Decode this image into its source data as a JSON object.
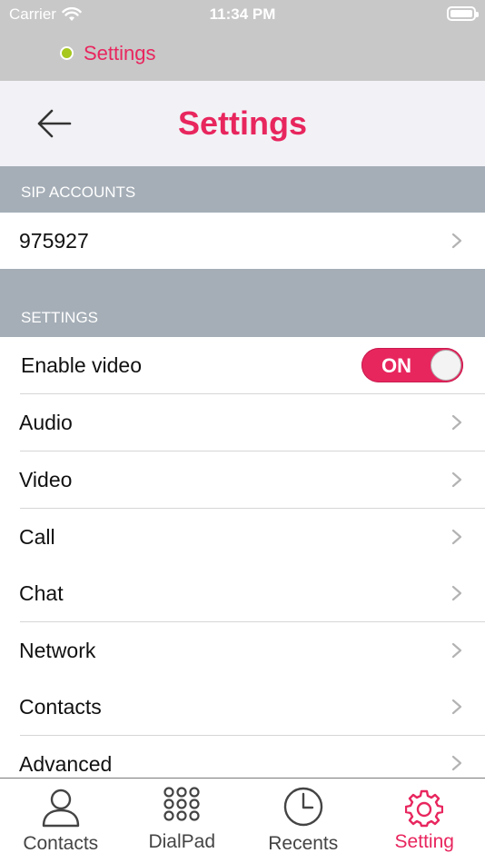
{
  "status_bar": {
    "carrier": "Carrier",
    "time": "11:34 PM",
    "icons": [
      "wifi-icon",
      "battery-icon"
    ]
  },
  "registration": {
    "status_text": "Settings",
    "indicator_color": "#a6c81f"
  },
  "nav": {
    "title": "Settings",
    "back_icon": "arrow-left-icon"
  },
  "sections": {
    "sip_accounts": {
      "header": "SIP ACCOUNTS",
      "items": [
        {
          "label": "975927"
        }
      ]
    },
    "settings": {
      "header": "SETTINGS",
      "enable_video": {
        "label": "Enable video",
        "toggle_text": "ON",
        "value": true
      },
      "items": [
        {
          "label": "Audio"
        },
        {
          "label": "Video"
        },
        {
          "label": "Call"
        },
        {
          "label": "Chat"
        },
        {
          "label": "Network"
        },
        {
          "label": "Contacts"
        },
        {
          "label": "Advanced"
        }
      ]
    }
  },
  "tab_bar": {
    "tabs": [
      {
        "label": "Contacts",
        "icon": "person-icon",
        "active": false
      },
      {
        "label": "DialPad",
        "icon": "dialpad-icon",
        "active": false
      },
      {
        "label": "Recents",
        "icon": "clock-icon",
        "active": false
      },
      {
        "label": "Setting",
        "icon": "gear-icon",
        "active": true
      }
    ]
  },
  "colors": {
    "accent": "#e8265e",
    "section_header_bg": "#a5aeb7",
    "status_bar_bg": "#c8c8c8",
    "nav_bg": "#f2f2f6"
  }
}
